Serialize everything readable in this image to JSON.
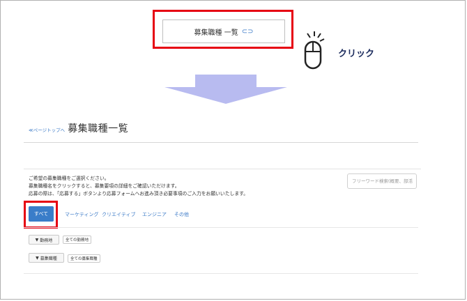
{
  "top_button": {
    "label": "募集職種 一覧"
  },
  "click_label": "クリック",
  "breadcrumb": {
    "link": "≪ページトップへ"
  },
  "page_title": "募集職種一覧",
  "intro": [
    "ご希望の募集職種をご選択ください。",
    "募集職種名をクリックすると、募集要項の詳細をご確認いただけます。",
    "応募の際は、「応募する」ボタンより応募フォームへお進み頂き必要事項のご入力をお願いいたします。"
  ],
  "search": {
    "placeholder": "フリーワード検索(概要、部活"
  },
  "tabs": [
    "すべて",
    "マーケティング",
    "クリエイティブ",
    "エンジニア",
    "その他"
  ],
  "filters": [
    {
      "button": "勤務地",
      "tag": "全ての勤務地"
    },
    {
      "button": "募集職種",
      "tag": "全ての募集職種"
    }
  ],
  "colors": {
    "highlight": "#e60012",
    "accent": "#3a7dc9",
    "arrow": "#b8bbf0"
  }
}
